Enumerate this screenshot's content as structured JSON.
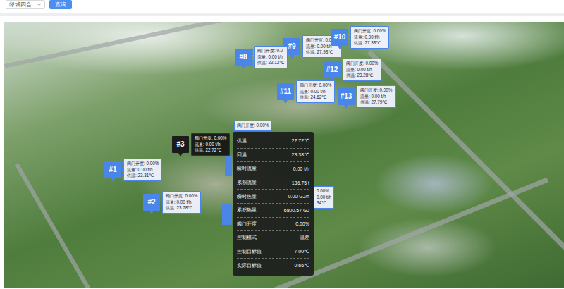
{
  "toolbar": {
    "community": "绿城四合",
    "query_button": "查询"
  },
  "markers": [
    {
      "label": "#1",
      "lines": [
        "阀门开度: 0.00%",
        "流量: 0.00 t/h",
        "供温: 23.31℃"
      ],
      "selected": false
    },
    {
      "label": "#2",
      "lines": [
        "阀门开度: 0.00%",
        "流量: 0.00 t/h",
        "供温: 23.78℃"
      ],
      "selected": false
    },
    {
      "label": "#9",
      "lines": [
        "阀门开度: 0.00%",
        "流量: 0.00 t/h",
        "供温: 27.93℃"
      ],
      "selected": false
    },
    {
      "label": "#10",
      "lines": [
        "阀门开度: 0.00%",
        "流量: 0.00 t/h",
        "供温: 27.38℃"
      ],
      "selected": false
    },
    {
      "label": "#12",
      "lines": [
        "阀门开度: 0.00%",
        "流量: 0.00 t/h",
        "供温: 23.28℃"
      ],
      "selected": false
    },
    {
      "label": "#13",
      "lines": [
        "阀门开度: 0.00%",
        "流量: 0.00 t/h",
        "供温: 27.79℃"
      ],
      "selected": false
    },
    {
      "label": "#11",
      "lines": [
        "阀门开度: 0.00%",
        "流量: 0.00 t/h",
        "供温: 24.62℃"
      ],
      "selected": false
    },
    {
      "label": "#8",
      "lines": [
        "阀门开度: 0.0",
        "流量: 0.00 t/h",
        "供温: 22.12℃"
      ],
      "selected": false
    },
    {
      "label": "#3",
      "lines": [
        "阀门开度: 0.00%",
        "流量: 0.00 t/h",
        "供温: 22.72℃"
      ],
      "selected": true
    }
  ],
  "partial_markers": [
    {
      "lines": [
        "阀门开度: 0.00%"
      ]
    },
    {
      "lines": [
        "0.00%",
        "0.00 t/h",
        "34℃"
      ]
    },
    {
      "lines": []
    },
    {
      "lines": []
    }
  ],
  "tooltip": {
    "rows": [
      {
        "label": "供温",
        "value": "22.72℃"
      },
      {
        "label": "回温",
        "value": "23.38℃"
      },
      {
        "label": "瞬时流量",
        "value": "0.00 t/h"
      },
      {
        "label": "累积流量",
        "value": "136.75 t"
      },
      {
        "label": "瞬时热量",
        "value": "0.00 GJ/h"
      },
      {
        "label": "累积热量",
        "value": "6800.57 GJ"
      },
      {
        "label": "阀门开度",
        "value": "0.00%"
      },
      {
        "label": "控制模式",
        "value": "温差"
      },
      {
        "label": "控制目标值",
        "value": "7.00℃"
      },
      {
        "label": "实际目标值",
        "value": "-0.66℃"
      }
    ]
  }
}
